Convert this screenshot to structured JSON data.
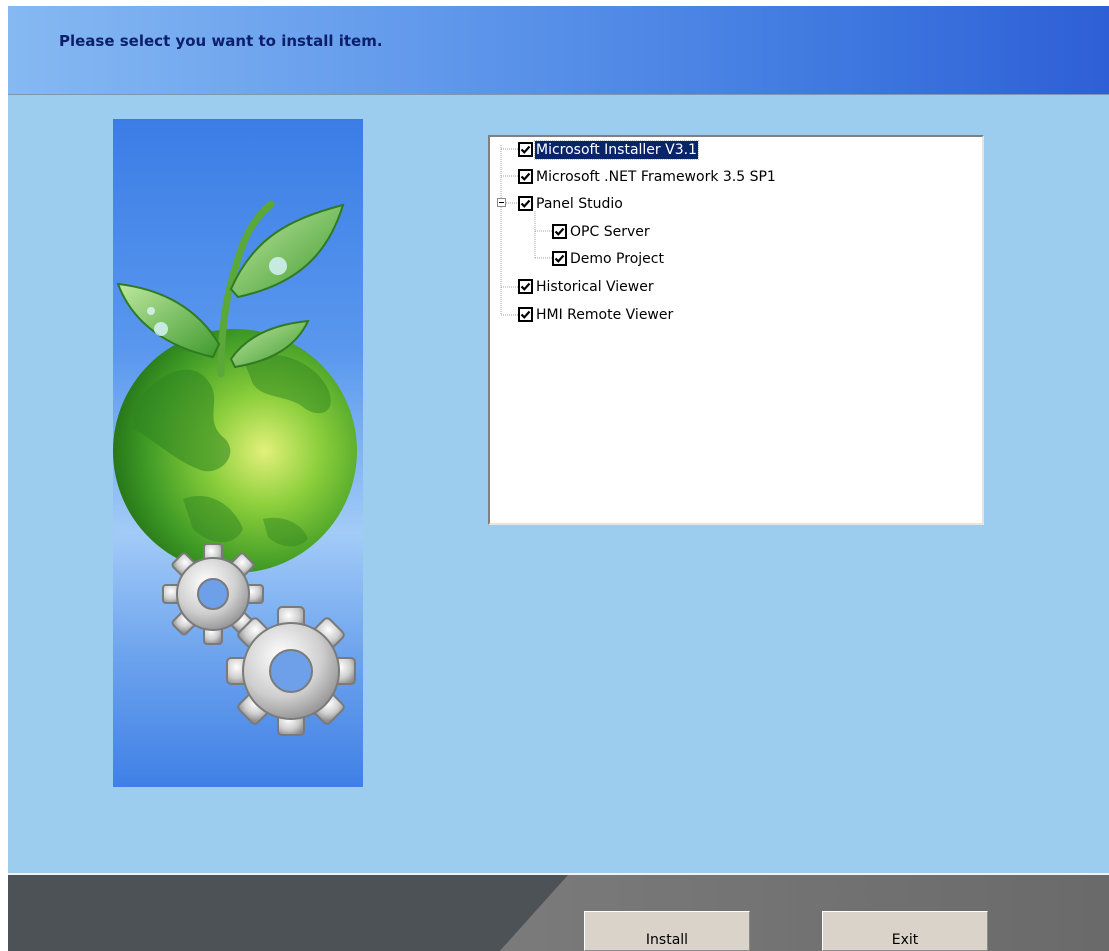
{
  "header": {
    "title": "Please select you want to install item."
  },
  "tree": {
    "items": [
      {
        "label": "Microsoft Installer V3.1",
        "checked": true,
        "selected": true,
        "level": 0
      },
      {
        "label": "Microsoft .NET Framework 3.5 SP1",
        "checked": true,
        "level": 0
      },
      {
        "label": "Panel Studio",
        "checked": true,
        "level": 0,
        "expanded": true
      },
      {
        "label": "OPC Server",
        "checked": true,
        "level": 1
      },
      {
        "label": "Demo Project",
        "checked": true,
        "level": 1
      },
      {
        "label": "Historical Viewer",
        "checked": true,
        "level": 0
      },
      {
        "label": "HMI Remote Viewer",
        "checked": true,
        "level": 0
      }
    ]
  },
  "footer": {
    "install_label": "Install",
    "exit_label": "Exit"
  },
  "colors": {
    "background": "#9dcdee",
    "title_text": "#0c1f6b",
    "selection": "#0a246a"
  }
}
